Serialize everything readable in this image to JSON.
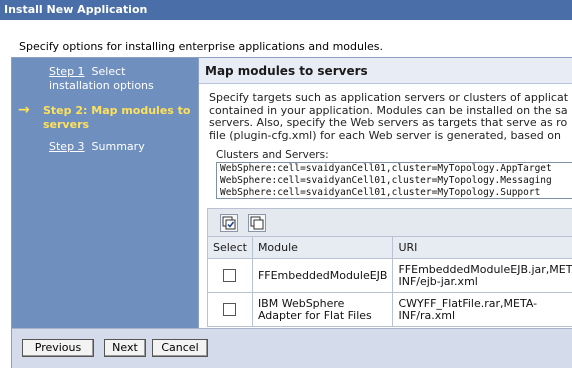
{
  "window": {
    "title": "Install New Application"
  },
  "intro": "Specify options for installing enterprise applications and modules.",
  "steps": [
    {
      "num": "Step 1",
      "label": "Select installation options"
    },
    {
      "num": "Step 2:",
      "label": "Map modules to servers"
    },
    {
      "num": "Step 3",
      "label": "Summary"
    }
  ],
  "current_step_arrow": "→",
  "panel": {
    "title": "Map modules to servers",
    "description_lines": [
      "Specify targets such as application servers or clusters of applicati",
      "contained in your application. Modules can be installed on the sa",
      "servers. Also, specify the Web servers as targets that serve as ro",
      "file (plugin-cfg.xml) for each Web server is generated, based on"
    ],
    "clusters_label": "Clusters and Servers:",
    "clusters": [
      "WebSphere:cell=svaidyanCell01,cluster=MyTopology.AppTarget",
      "WebSphere:cell=svaidyanCell01,cluster=MyTopology.Messaging",
      "WebSphere:cell=svaidyanCell01,cluster=MyTopology.Support"
    ],
    "toolbar_icons": [
      "select-all-icon",
      "deselect-all-icon"
    ],
    "table": {
      "headers": [
        "Select",
        "Module",
        "URI"
      ],
      "rows": [
        {
          "module": "FFEmbeddedModuleEJB",
          "uri": "FFEmbeddedModuleEJB.jar,META-INF/ejb-jar.xml",
          "checked": false
        },
        {
          "module": "IBM WebSphere Adapter for Flat Files",
          "uri": "CWYFF_FlatFile.rar,META-INF/ra.xml",
          "checked": false
        }
      ]
    }
  },
  "buttons": {
    "previous": "Previous",
    "next": "Next",
    "cancel": "Cancel"
  },
  "colors": {
    "title_bar": "#4a6ea8",
    "steps_panel": "#6f8fbf",
    "current_step": "#ffe15a"
  }
}
